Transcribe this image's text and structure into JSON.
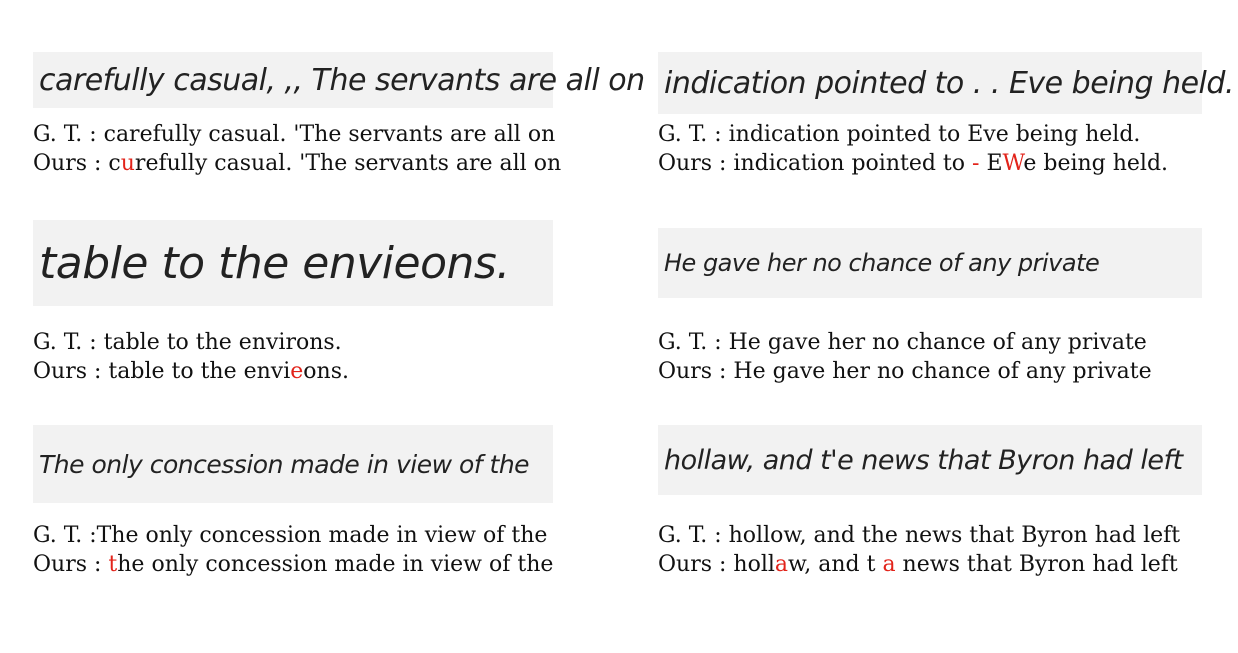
{
  "colors": {
    "error": "#e2231a",
    "text": "#111111"
  },
  "samples": [
    {
      "handwriting": "carefully casual, ,, The servants are all on",
      "gt_label": "G.  T. :",
      "gt_text": " carefully casual. 'The servants are all on",
      "ours_label": "Ours :",
      "ours_parts": [
        " c",
        "u",
        "refully casual. 'The servants are all on"
      ]
    },
    {
      "handwriting": "indication pointed to . . Eve being held.",
      "gt_label": "G.  T. :",
      "gt_text": " indication pointed to Eve being held.",
      "ours_label": "Ours :",
      "ours_parts": [
        " indication pointed to ",
        "-",
        " E",
        "W",
        "e being held."
      ]
    },
    {
      "handwriting": "table  to the envieons.",
      "gt_label": "G.  T. :",
      "gt_text": " table to the environs.",
      "ours_label": "Ours :",
      "ours_parts": "  table to the envi|e|ons."
    },
    {
      "handwriting": "He gave her no chance of any private",
      "gt_label": "G.  T. :",
      "gt_text": " He gave her no chance of any private",
      "ours_label": "Ours :",
      "ours_text": "  He gave her no chance of any private"
    },
    {
      "handwriting": "The only concession made in view of the",
      "gt_label": "G.  T. :",
      "gt_text": "The only concession made in view of the",
      "ours_label": "Ours :",
      "ours_parts": [
        " ",
        "t",
        "he only concession made in view of the"
      ]
    },
    {
      "handwriting": "hollaw, and t'e news that Byron had left",
      "gt_label": "G.  T. :",
      "gt_text": " hollow, and the news that Byron had left",
      "ours_label": "Ours :",
      "ours_parts": [
        "  holl",
        "a",
        "w, and t ",
        "a",
        " news that Byron had left"
      ]
    }
  ]
}
